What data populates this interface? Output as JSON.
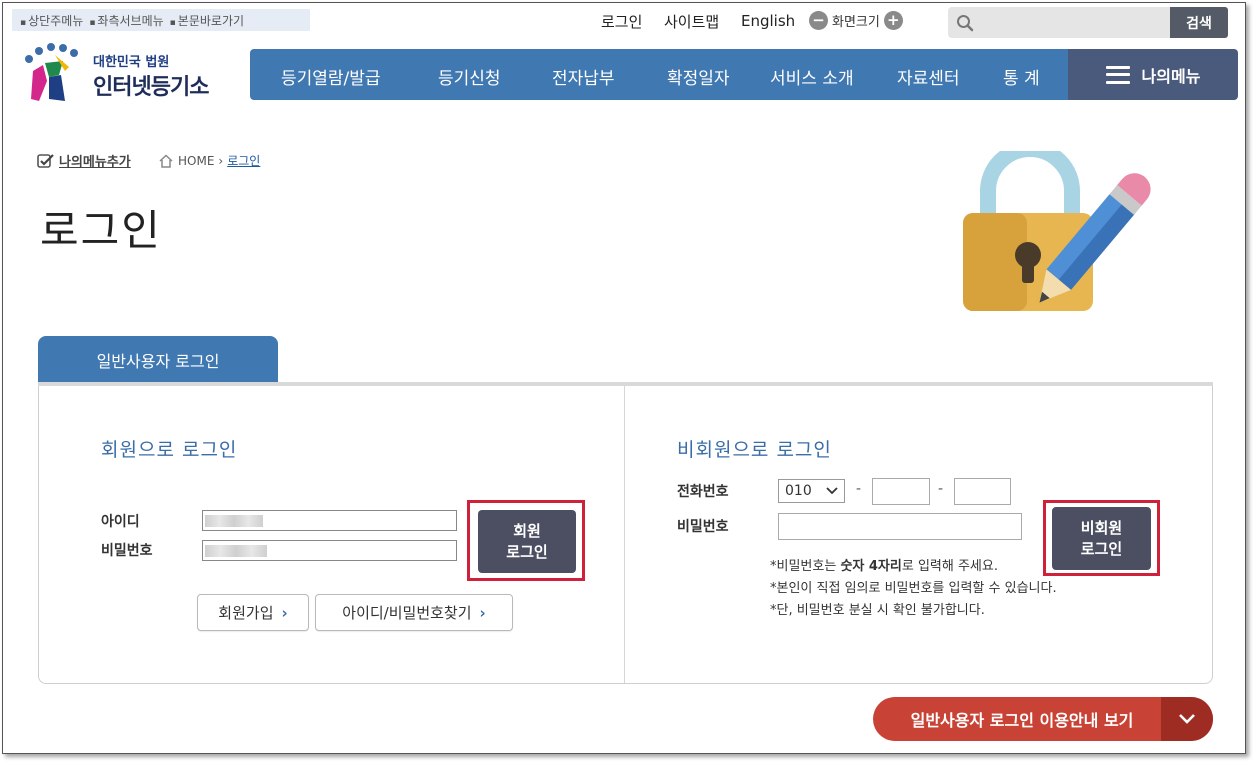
{
  "skip_links": [
    "상단주메뉴",
    "좌측서브메뉴",
    "본문바로가기"
  ],
  "util": {
    "login": "로그인",
    "sitemap": "사이트맵",
    "english": "English",
    "zoom_label": "화면크기"
  },
  "search": {
    "button": "검색",
    "placeholder": ""
  },
  "logo": {
    "line1": "대한민국 법원",
    "line2": "인터넷등기소"
  },
  "gnb": [
    "등기열람/발급",
    "등기신청",
    "전자납부",
    "확정일자",
    "서비스 소개",
    "자료센터",
    "통 계"
  ],
  "my_menu": "나의메뉴",
  "add_menu": "나의메뉴추가",
  "breadcrumb": {
    "home": "HOME",
    "current": "로그인"
  },
  "page_title": "로그인",
  "tab": "일반사용자 로그인",
  "member": {
    "heading": "회원으로 로그인",
    "id_label": "아이디",
    "pw_label": "비밀번호",
    "login_line1": "회원",
    "login_line2": "로그인",
    "join": "회원가입",
    "find": "아이디/비밀번호찾기"
  },
  "guest": {
    "heading": "비회원으로 로그인",
    "phone_label": "전화번호",
    "phone_prefix": "010",
    "dash": "-",
    "pw_label": "비밀번호",
    "login_line1": "비회원",
    "login_line2": "로그인",
    "note1_a": "*비밀번호는 ",
    "note1_b": "숫자 4자리",
    "note1_c": "로 입력해 주세요.",
    "note2": "*본인이 직접 임의로 비밀번호를 입력할 수 있습니다.",
    "note3": "*단, 비밀번호 분실 시 확인 불가합니다."
  },
  "guide_button": "일반사용자 로그인 이용안내 보기",
  "colors": {
    "nav_blue": "#4078b2",
    "dark_button": "#4b4f61",
    "highlight_red": "#d0213b",
    "guide_red": "#c84235"
  }
}
